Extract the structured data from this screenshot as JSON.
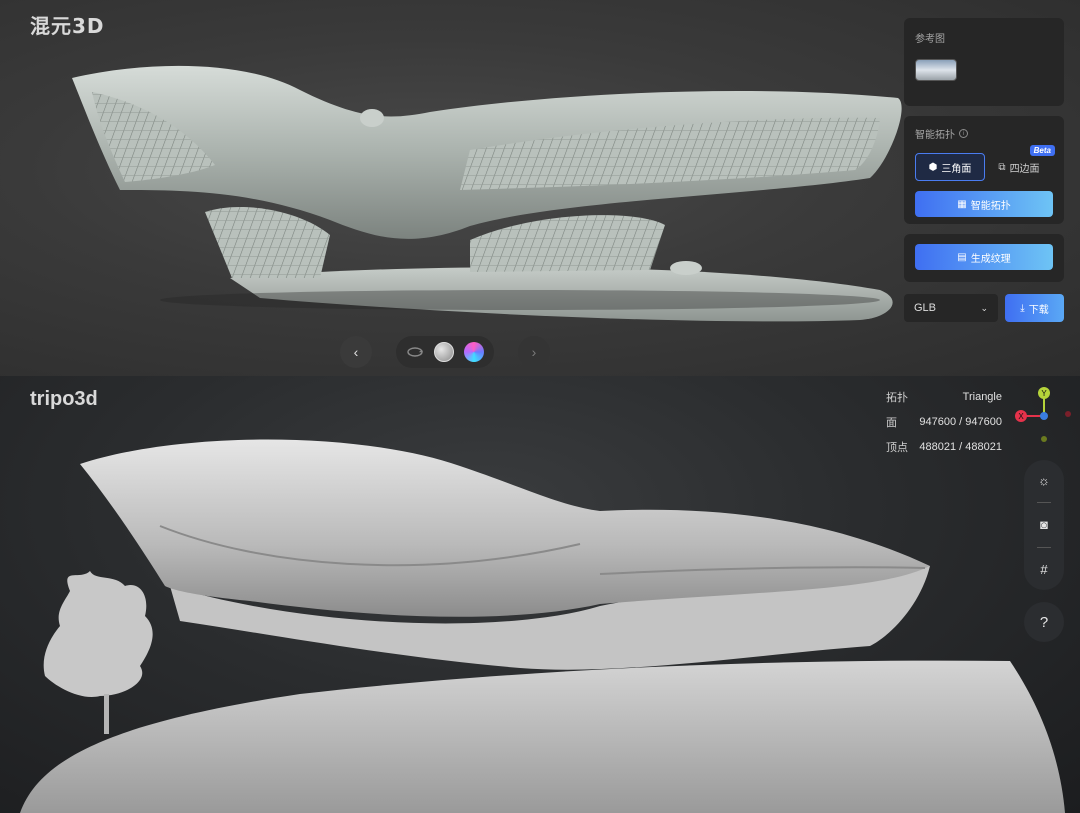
{
  "top_panel": {
    "brand": "混元3D",
    "reference": {
      "label": "参考图"
    },
    "topology": {
      "label": "智能拓扑",
      "options": [
        {
          "label": "三角面",
          "icon": "triangle-mesh-icon",
          "active": true
        },
        {
          "label": "四边面",
          "icon": "quad-mesh-icon",
          "active": false
        }
      ],
      "badge": "Beta",
      "action": "智能拓扑"
    },
    "texture": {
      "action": "生成纹理"
    },
    "export": {
      "format": "GLB",
      "download": "下载"
    },
    "colors": {
      "accent": "#3f6ff2",
      "accent_end": "#6ec4f5"
    }
  },
  "bottom_panel": {
    "brand": "tripo3d",
    "stats": [
      {
        "key": "拓扑",
        "value": "Triangle"
      },
      {
        "key": "面",
        "value": "947600 / 947600"
      },
      {
        "key": "顶点",
        "value": "488021 / 488021"
      }
    ],
    "axis": {
      "y": "Y",
      "x": "X"
    },
    "help": "?"
  }
}
